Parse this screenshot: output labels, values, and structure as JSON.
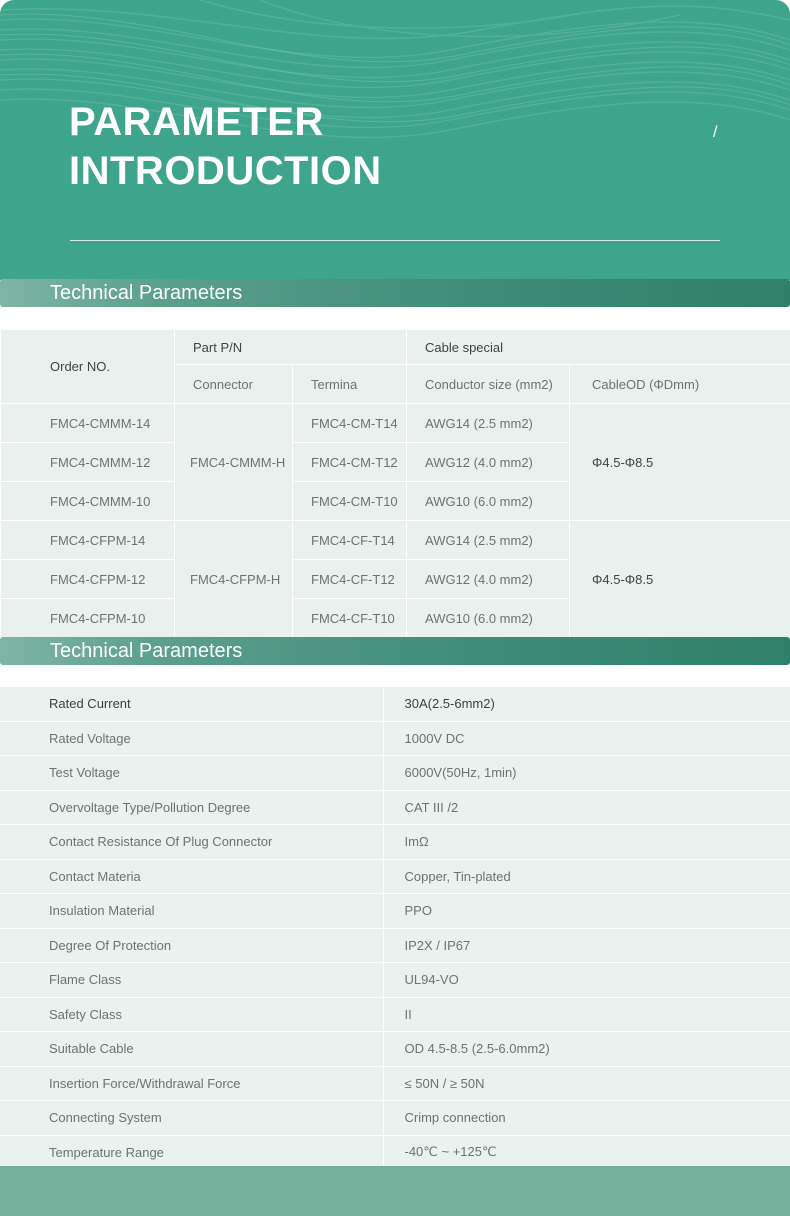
{
  "hero": {
    "title_line1": "PARAMETER",
    "title_line2": "INTRODUCTION",
    "slash": "/"
  },
  "section1": {
    "title": "Technical Parameters"
  },
  "section2": {
    "title": "Technical Parameters"
  },
  "table1": {
    "order_header": "Order NO.",
    "part_header": "Part P/N",
    "cable_header": "Cable special",
    "connector_header": "Connector",
    "terminal_header": "Termina",
    "conductor_header": "Conductor size (mm2)",
    "od_header": "CableOD (ΦDmm)",
    "groups": [
      {
        "connector": "FMC4-CMMM-H",
        "od": "Φ4.5-Φ8.5",
        "rows": [
          {
            "order": "FMC4-CMMM-14",
            "terminal": "FMC4-CM-T14",
            "size": "AWG14 (2.5 mm2)"
          },
          {
            "order": "FMC4-CMMM-12",
            "terminal": "FMC4-CM-T12",
            "size": "AWG12 (4.0 mm2)"
          },
          {
            "order": "FMC4-CMMM-10",
            "terminal": "FMC4-CM-T10",
            "size": "AWG10 (6.0 mm2)"
          }
        ]
      },
      {
        "connector": "FMC4-CFPM-H",
        "od": "Φ4.5-Φ8.5",
        "rows": [
          {
            "order": "FMC4-CFPM-14",
            "terminal": "FMC4-CF-T14",
            "size": "AWG14 (2.5 mm2)"
          },
          {
            "order": "FMC4-CFPM-12",
            "terminal": "FMC4-CF-T12",
            "size": "AWG12 (4.0 mm2)"
          },
          {
            "order": "FMC4-CFPM-10",
            "terminal": "FMC4-CF-T10",
            "size": "AWG10 (6.0 mm2)"
          }
        ]
      }
    ]
  },
  "table2": {
    "rows": [
      {
        "key": "Rated Current",
        "value": "30A(2.5-6mm2)"
      },
      {
        "key": "Rated Voltage",
        "value": "1000V DC"
      },
      {
        "key": "Test Voltage",
        "value": "6000V(50Hz, 1min)"
      },
      {
        "key": "Overvoltage Type/Pollution Degree",
        "value": "CAT III /2"
      },
      {
        "key": "Contact Resistance Of Plug Connector",
        "value": "ImΩ"
      },
      {
        "key": "Contact Materia",
        "value": "Copper, Tin-plated"
      },
      {
        "key": "Insulation Material",
        "value": "PPO"
      },
      {
        "key": "Degree Of Protection",
        "value": "IP2X / IP67"
      },
      {
        "key": "Flame Class",
        "value": "UL94-VO"
      },
      {
        "key": "Safety Class",
        "value": "II"
      },
      {
        "key": "Suitable Cable",
        "value": "OD 4.5-8.5 (2.5-6.0mm2)"
      },
      {
        "key": "Insertion Force/Withdrawal Force",
        "value": "≤ 50N / ≥ 50N"
      },
      {
        "key": "Connecting System",
        "value": "Crimp connection"
      },
      {
        "key": "Temperature Range",
        "value": "-40℃ ~ +125℃"
      }
    ]
  }
}
